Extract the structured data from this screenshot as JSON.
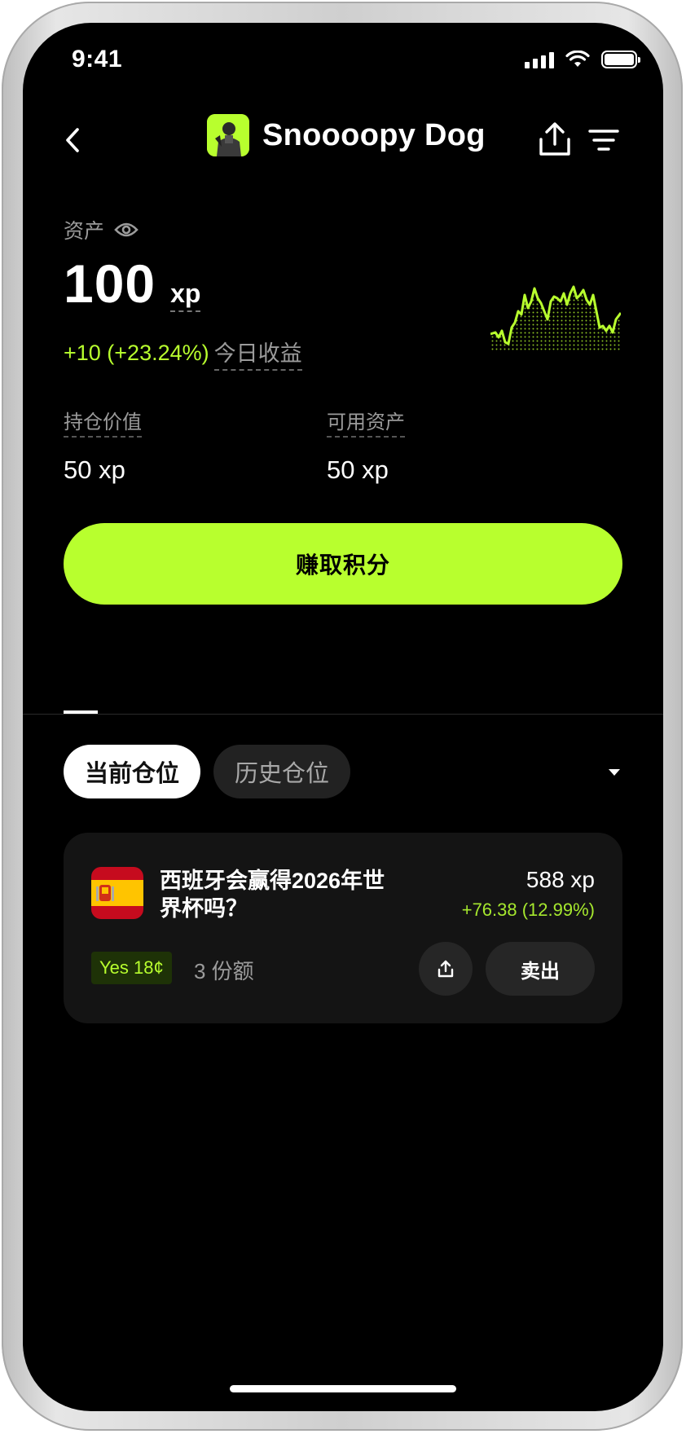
{
  "status_bar": {
    "time": "9:41"
  },
  "nav": {
    "title": "Snoooopy Dog",
    "icons": {
      "back": "chevron-left-icon",
      "share": "share-icon",
      "filter": "filter-icon"
    }
  },
  "assets": {
    "label": "资产",
    "value": "100",
    "unit": "xp",
    "pnl": "+10 (+23.24%)",
    "pnl_label": "今日收益"
  },
  "stats": {
    "position_value_label": "持仓价值",
    "position_value": "50 xp",
    "available_label": "可用资产",
    "available_value": "50 xp"
  },
  "earn_button": "赚取积分",
  "filters": {
    "current": "当前仓位",
    "history": "历史仓位"
  },
  "position": {
    "title": "西班牙会赢得2026年世界杯吗？",
    "value": "588 xp",
    "pnl": "+76.38 (12.99%)",
    "outcome_tag": "Yes 18¢",
    "shares": "3 份额",
    "sell_label": "卖出"
  },
  "colors": {
    "accent": "#b8ff2e",
    "background": "#000000",
    "card": "#141414",
    "muted_text": "#9b9b9b"
  }
}
